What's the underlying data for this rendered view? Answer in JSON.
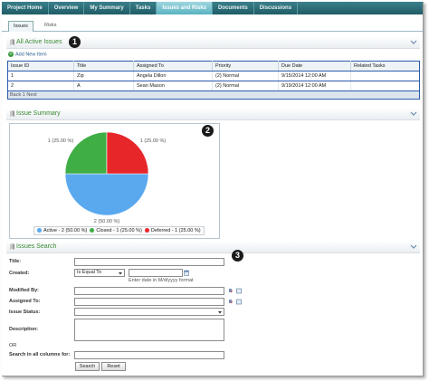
{
  "nav": {
    "tabs": [
      {
        "label": "Project Home"
      },
      {
        "label": "Overview"
      },
      {
        "label": "My Summary"
      },
      {
        "label": "Tasks"
      },
      {
        "label": "Issues and Risks"
      },
      {
        "label": "Documents"
      },
      {
        "label": "Discussions"
      }
    ],
    "active_index": 4
  },
  "subtabs": {
    "issues": "Issues",
    "risks": "Risks"
  },
  "active_issues": {
    "title": "All Active Issues",
    "add_new": "Add New Item",
    "columns": [
      "Issue ID",
      "Title",
      "Assigned To",
      "Priority",
      "Due Date",
      "Related Tasks"
    ],
    "rows": [
      [
        "1",
        "Zip",
        "Angela Dillon",
        "(2) Normal",
        "9/15/2014 12:00 AM",
        ""
      ],
      [
        "2",
        "A",
        "Sean Mason",
        "(2) Normal",
        "9/19/2014 12:00 AM",
        ""
      ]
    ],
    "back_link": "Back 1 Next"
  },
  "summary": {
    "title": "Issue Summary"
  },
  "chart_data": {
    "type": "pie",
    "categories": [
      "Active",
      "Closed",
      "Deferred"
    ],
    "values": [
      2,
      1,
      1
    ],
    "slice_labels": [
      "2 (50.00 %)",
      "1 (25.00 %)",
      "1 (25.00 %)"
    ],
    "legend": [
      "Active - 2 (50.00 %)",
      "Closed - 1 (25.00 %)",
      "Deferred - 1 (25.00 %)"
    ],
    "colors": [
      "#5aa9ef",
      "#3fae45",
      "#e7262a"
    ],
    "legend_position": "bottom"
  },
  "search": {
    "title": "Issues Search",
    "labels": {
      "title": "Title:",
      "created": "Created:",
      "modified_by": "Modified By:",
      "assigned_to": "Assigned To:",
      "issue_status": "Issue Status:",
      "description": "Description:",
      "or": "OR",
      "search_all": "Search in all columns for:"
    },
    "created_operator": "Is Equal To",
    "date_hint": "Enter date in M/d/yyyy format",
    "search_button": "Search",
    "reset_button": "Reset"
  },
  "callouts": [
    "1",
    "2",
    "3"
  ]
}
